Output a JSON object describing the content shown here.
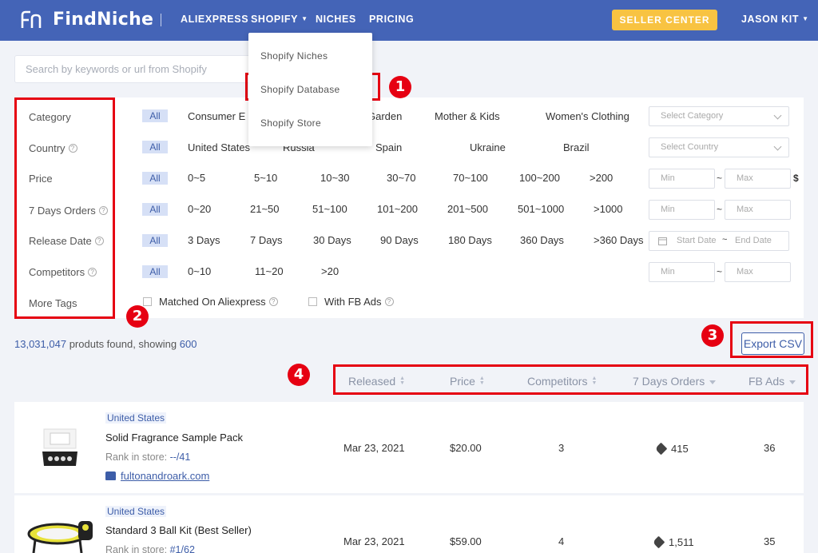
{
  "nav": {
    "brand": "FindNiche",
    "links": [
      "ALIEXPRESS",
      "SHOPIFY",
      "NICHES",
      "PRICING"
    ],
    "seller_center": "SELLER CENTER",
    "user": "JASON KIT"
  },
  "search": {
    "placeholder": "Search by keywords or url from Shopify"
  },
  "dropdown": {
    "items": [
      "Shopify Niches",
      "Shopify Database",
      "Shopify Store"
    ]
  },
  "filters": {
    "all": "All",
    "labels": [
      "Category",
      "Country",
      "Price",
      "7 Days Orders",
      "Release Date",
      "Competitors",
      "More Tags"
    ],
    "category_options": [
      "Consumer E",
      "Garden",
      "Mother & Kids",
      "Women's Clothing"
    ],
    "category_select": "Select Category",
    "country_options": [
      "United States",
      "Russia",
      "Spain",
      "Ukraine",
      "Brazil"
    ],
    "country_select": "Select Country",
    "price_options": [
      "0~5",
      "5~10",
      "10~30",
      "30~70",
      "70~100",
      "100~200",
      ">200"
    ],
    "orders_options": [
      "0~20",
      "21~50",
      "51~100",
      "101~200",
      "201~500",
      "501~1000",
      ">1000"
    ],
    "date_options": [
      "3 Days",
      "7 Days",
      "30 Days",
      "90 Days",
      "180 Days",
      "360 Days",
      ">360 Days"
    ],
    "competitor_options": [
      "0~10",
      "11~20",
      ">20"
    ],
    "min": "Min",
    "max": "Max",
    "currency": "$",
    "tilde": "~",
    "start_date": "Start Date",
    "end_date": "End Date",
    "date_sep": "~",
    "tags": [
      "Matched On Aliexpress",
      "With FB Ads"
    ]
  },
  "results": {
    "total": "13,031,047",
    "mid_text": "produts found, showing",
    "showing": "600",
    "export": "Export CSV"
  },
  "columns": [
    "Released",
    "Price",
    "Competitors",
    "7 Days Orders",
    "FB Ads"
  ],
  "annotations": [
    "1",
    "2",
    "3",
    "4"
  ],
  "products": [
    {
      "country": "United States",
      "title": "Solid Fragrance Sample Pack",
      "rank_label": "Rank in store:",
      "rank": "--/41",
      "store": "fultonandroark.com",
      "released": "Mar 23, 2021",
      "price": "$20.00",
      "competitors": "3",
      "orders": "415",
      "fb_ads": "36"
    },
    {
      "country": "United States",
      "title": "Standard 3 Ball Kit (Best Seller)",
      "rank_label": "Rank in store:",
      "rank": "#1/62",
      "store": "",
      "released": "Mar 23, 2021",
      "price": "$59.00",
      "competitors": "4",
      "orders": "1,511",
      "fb_ads": "35"
    }
  ]
}
